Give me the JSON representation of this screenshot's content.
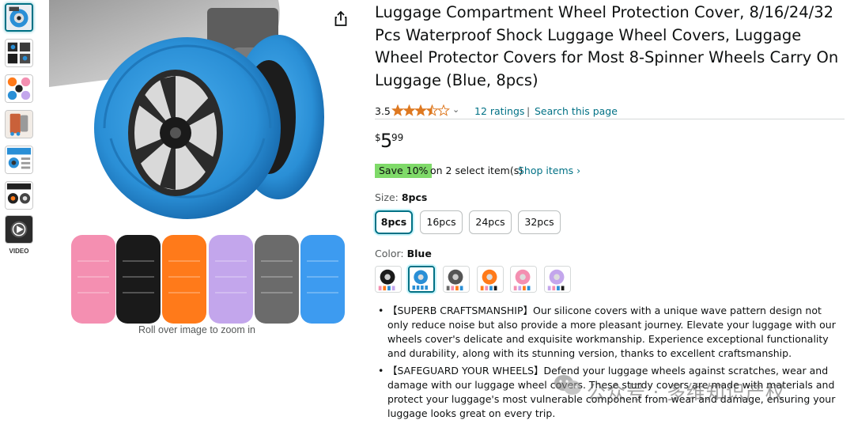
{
  "thumbnails": [
    {
      "name": "thumb-blue-wheel",
      "active": true
    },
    {
      "name": "thumb-sizes-grid"
    },
    {
      "name": "thumb-colors-grid"
    },
    {
      "name": "thumb-luggage"
    },
    {
      "name": "thumb-features"
    },
    {
      "name": "thumb-installation"
    },
    {
      "name": "thumb-video"
    }
  ],
  "video_label": "VIDEO",
  "zoom_hint": "Roll over image to zoom in",
  "product": {
    "title": "Luggage Compartment Wheel Protection Cover, 8/16/24/32 Pcs Waterproof Shock Luggage Wheel Covers, Luggage Wheel Protector Covers for Most 8-Spinner Wheels Carry On Luggage (Blue, 8pcs)",
    "rating_value": "3.5",
    "rating_stars": 3.5,
    "ratings_link": "12 ratings",
    "separator": "|",
    "search_link": "Search this page",
    "price_symbol": "$",
    "price_whole": "5",
    "price_fraction": "99",
    "save_badge": "Save 10%",
    "save_text": "on 2 select item(s)",
    "shop_items": "Shop items ›",
    "size_label": "Size: ",
    "size_selected": "8pcs",
    "sizes": [
      "8pcs",
      "16pcs",
      "24pcs",
      "32pcs"
    ],
    "color_label": "Color: ",
    "color_selected": "Blue",
    "colors": [
      "Black",
      "Blue",
      "Gray",
      "Orange",
      "Pink",
      "Purple"
    ],
    "bullets": [
      "【SUPERB CRAFTSMANSHIP】Our silicone covers with a unique wave pattern design not only reduce noise but also provide a more pleasant journey. Elevate your luggage with our wheels cover's delicate and exquisite workmanship. Experience exceptional functionality and durability, along with its stunning version, thanks to excellent craftsmanship.",
      "【SAFEGUARD YOUR WHEELS】Defend your luggage wheels against scratches, wear and damage with our luggage wheel covers. These sturdy covers are made with materials and protect your luggage's most vulnerable component from wear and damage, ensuring your luggage looks great on every trip."
    ]
  },
  "watermark": "公众号 · 多维知识产权",
  "colors": {
    "link": "#007185",
    "save_badge": "#7fda69",
    "selected_border": "#007185",
    "star": "#de7921",
    "wheel_blue": "#2a8fd6",
    "cover_pink": "#f48fb1",
    "cover_black": "#1a1a1a",
    "cover_orange": "#ff7a1a",
    "cover_purple": "#c3a6ec",
    "cover_gray": "#6b6b6b",
    "cover_lightblue": "#3d9bf0"
  },
  "icons": {
    "share": "share-icon",
    "chevron": "chevron-down-icon",
    "star": "star-icon"
  }
}
